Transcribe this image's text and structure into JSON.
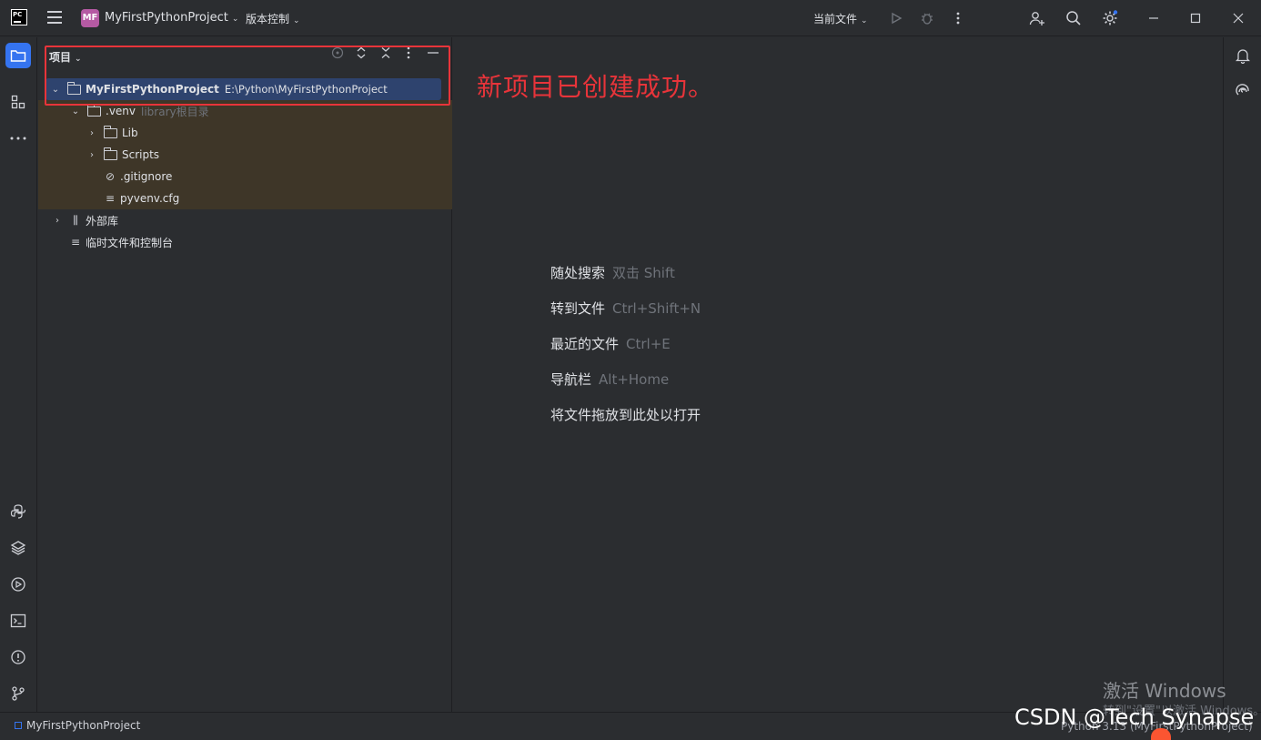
{
  "app": {
    "project_badge": "MF",
    "project_name": "MyFirstPythonProject",
    "vcs_label": "版本控制",
    "current_file_label": "当前文件",
    "logo_text": "PC"
  },
  "project_panel": {
    "title": "项目",
    "tree": [
      {
        "label": "MyFirstPythonProject",
        "extra": "E:\\Python\\MyFirstPythonProject"
      },
      {
        "label": ".venv",
        "extra": "library根目录"
      },
      {
        "label": "Lib"
      },
      {
        "label": "Scripts"
      },
      {
        "label": ".gitignore"
      },
      {
        "label": "pyvenv.cfg"
      },
      {
        "label": "外部库"
      },
      {
        "label": "临时文件和控制台"
      }
    ]
  },
  "annotation": "新项目已创建成功。",
  "editor_hints": [
    {
      "action": "随处搜索",
      "shortcut": "双击 Shift"
    },
    {
      "action": "转到文件",
      "shortcut": "Ctrl+Shift+N"
    },
    {
      "action": "最近的文件",
      "shortcut": "Ctrl+E"
    },
    {
      "action": "导航栏",
      "shortcut": "Alt+Home"
    },
    {
      "action": "将文件拖放到此处以打开",
      "shortcut": ""
    }
  ],
  "status_bar": {
    "breadcrumb": "MyFirstPythonProject",
    "interpreter": "Python 3.13 (MyFirstPythonProject)"
  },
  "overlay": {
    "activate_title": "激活 Windows",
    "activate_sub": "转到\"设置\"以激活 Windows。",
    "watermark": "CSDN @Tech Synapse"
  },
  "colors": {
    "accent": "#3574f0",
    "annotation_red": "#e8343a",
    "selection": "#2e436e",
    "venv_highlight": "#3e3628"
  }
}
